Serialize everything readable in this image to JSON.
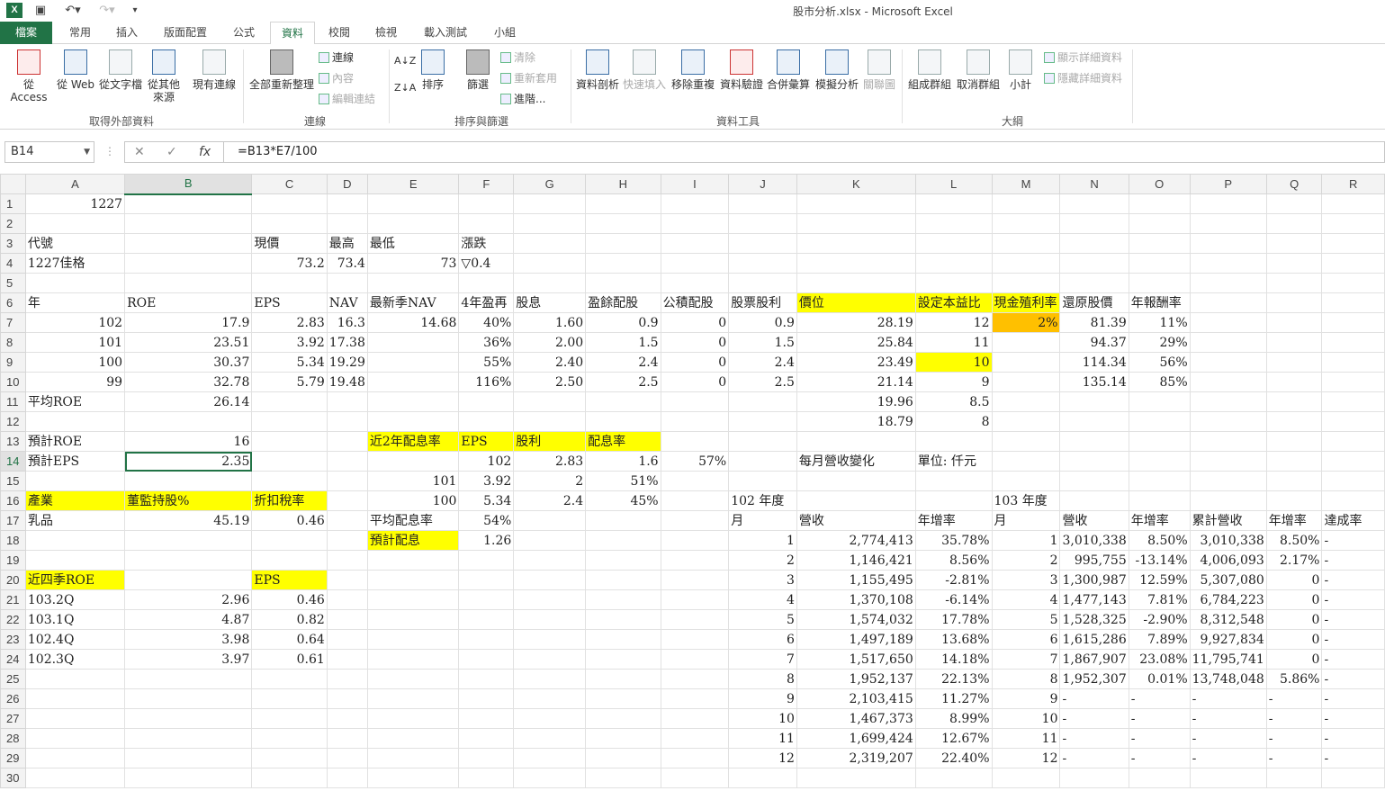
{
  "window": {
    "title": "股市分析.xlsx - Microsoft Excel",
    "app_icon": "excel-logo",
    "qa": [
      "save-icon",
      "undo-icon",
      "redo-icon",
      "customize-icon"
    ]
  },
  "tabs": [
    "檔案",
    "常用",
    "插入",
    "版面配置",
    "公式",
    "資料",
    "校閱",
    "檢視",
    "載入測試",
    "小組"
  ],
  "ribbon": {
    "ext": [
      "從 Access",
      "從 Web",
      "從文字檔",
      "從其他",
      "來源",
      "現有連線"
    ],
    "ext_group": "取得外部資料",
    "conn": [
      "全部重新整理",
      "連線",
      "內容",
      "編輯連結"
    ],
    "conn_group": "連線",
    "sort": [
      "排序",
      "篩選",
      "清除",
      "重新套用",
      "進階..."
    ],
    "sort_group": "排序與篩選",
    "tools": [
      "資料剖析",
      "快速填入",
      "移除重複",
      "資料驗證",
      "合併彙算",
      "模擬分析",
      "關聯圖"
    ],
    "tools_group": "資料工具",
    "outline": [
      "組成群組",
      "取消群組",
      "小計",
      "顯示詳細資料",
      "隱藏詳細資料"
    ],
    "outline_group": "大綱"
  },
  "formula_bar": {
    "name_box": "B14",
    "formula": "=B13*E7/100"
  },
  "sheet": {
    "cols": [
      "A",
      "B",
      "C",
      "D",
      "E",
      "F",
      "G",
      "H",
      "I",
      "J",
      "K",
      "L",
      "M",
      "N",
      "O",
      "P",
      "Q",
      "R"
    ],
    "rows": [
      [
        "1227",
        "",
        "",
        "",
        "",
        "",
        "",
        "",
        "",
        "",
        "",
        "",
        "",
        "",
        "",
        "",
        "",
        ""
      ],
      [
        "",
        "",
        "",
        "",
        "",
        "",
        "",
        "",
        "",
        "",
        "",
        "",
        "",
        "",
        "",
        "",
        "",
        ""
      ],
      [
        "代號",
        "",
        "現價",
        "最高",
        "最低",
        "漲跌",
        "",
        "",
        "",
        "",
        "",
        "",
        "",
        "",
        "",
        "",
        "",
        ""
      ],
      [
        "1227佳格",
        "",
        "73.2",
        "73.4",
        "73",
        "▽0.4",
        "",
        "",
        "",
        "",
        "",
        "",
        "",
        "",
        "",
        "",
        "",
        ""
      ],
      [
        "",
        "",
        "",
        "",
        "",
        "",
        "",
        "",
        "",
        "",
        "",
        "",
        "",
        "",
        "",
        "",
        "",
        ""
      ],
      [
        "年",
        "ROE",
        "EPS",
        "NAV",
        "最新季NAV",
        "4年盈再",
        "股息",
        "盈餘配股",
        "公積配股",
        "股票股利",
        "價位",
        "設定本益比",
        "現金殖利率",
        "還原股價",
        "年報酬率",
        "",
        "",
        ""
      ],
      [
        "102",
        "17.9",
        "2.83",
        "16.3",
        "14.68",
        "40%",
        "1.60",
        "0.9",
        "0",
        "0.9",
        "28.19",
        "12",
        "2%",
        "81.39",
        "11%",
        "",
        "",
        ""
      ],
      [
        "101",
        "23.51",
        "3.92",
        "17.38",
        "",
        "36%",
        "2.00",
        "1.5",
        "0",
        "1.5",
        "25.84",
        "11",
        "",
        "94.37",
        "29%",
        "",
        "",
        ""
      ],
      [
        "100",
        "30.37",
        "5.34",
        "19.29",
        "",
        "55%",
        "2.40",
        "2.4",
        "0",
        "2.4",
        "23.49",
        "10",
        "",
        "114.34",
        "56%",
        "",
        "",
        ""
      ],
      [
        "99",
        "32.78",
        "5.79",
        "19.48",
        "",
        "116%",
        "2.50",
        "2.5",
        "0",
        "2.5",
        "21.14",
        "9",
        "",
        "135.14",
        "85%",
        "",
        "",
        ""
      ],
      [
        "平均ROE",
        "26.14",
        "",
        "",
        "",
        "",
        "",
        "",
        "",
        "",
        "19.96",
        "8.5",
        "",
        "",
        "",
        "",
        "",
        ""
      ],
      [
        "",
        "",
        "",
        "",
        "",
        "",
        "",
        "",
        "",
        "",
        "18.79",
        "8",
        "",
        "",
        "",
        "",
        "",
        ""
      ],
      [
        "預計ROE",
        "16",
        "",
        "",
        "近2年配息率",
        "EPS",
        "股利",
        "配息率",
        "",
        "",
        "",
        "",
        "",
        "",
        "",
        "",
        "",
        ""
      ],
      [
        "預計EPS",
        "2.35",
        "",
        "",
        "",
        "102",
        "2.83",
        "1.6",
        "57%",
        "",
        "每月營收變化",
        "單位: 仟元",
        "",
        "",
        "",
        "",
        "",
        ""
      ],
      [
        "",
        "",
        "",
        "",
        "101",
        "3.92",
        "2",
        "51%",
        "",
        "",
        "",
        "",
        "",
        "",
        "",
        "",
        "",
        ""
      ],
      [
        "產業",
        "董監持股%",
        "折扣稅率",
        "",
        "100",
        "5.34",
        "2.4",
        "45%",
        "",
        "102 年度",
        "",
        "",
        "103 年度",
        "",
        "",
        "",
        "",
        ""
      ],
      [
        "乳品",
        "45.19",
        "0.46",
        "",
        "平均配息率",
        "54%",
        "",
        "",
        "",
        "月",
        "營收",
        "年增率",
        "月",
        "營收",
        "年增率",
        "累計營收",
        "年增率",
        "達成率"
      ],
      [
        "",
        "",
        "",
        "",
        "預計配息",
        "1.26",
        "",
        "",
        "",
        "1",
        "2,774,413",
        "35.78%",
        "1",
        "3,010,338",
        "8.50%",
        "3,010,338",
        "8.50%",
        "-"
      ],
      [
        "",
        "",
        "",
        "",
        "",
        "",
        "",
        "",
        "",
        "2",
        "1,146,421",
        "8.56%",
        "2",
        "995,755",
        "-13.14%",
        "4,006,093",
        "2.17%",
        "-"
      ],
      [
        "近四季ROE",
        "",
        "EPS",
        "",
        "",
        "",
        "",
        "",
        "",
        "3",
        "1,155,495",
        "-2.81%",
        "3",
        "1,300,987",
        "12.59%",
        "5,307,080",
        "0",
        "-"
      ],
      [
        "103.2Q",
        "2.96",
        "0.46",
        "",
        "",
        "",
        "",
        "",
        "",
        "4",
        "1,370,108",
        "-6.14%",
        "4",
        "1,477,143",
        "7.81%",
        "6,784,223",
        "0",
        "-"
      ],
      [
        "103.1Q",
        "4.87",
        "0.82",
        "",
        "",
        "",
        "",
        "",
        "",
        "5",
        "1,574,032",
        "17.78%",
        "5",
        "1,528,325",
        "-2.90%",
        "8,312,548",
        "0",
        "-"
      ],
      [
        "102.4Q",
        "3.98",
        "0.64",
        "",
        "",
        "",
        "",
        "",
        "",
        "6",
        "1,497,189",
        "13.68%",
        "6",
        "1,615,286",
        "7.89%",
        "9,927,834",
        "0",
        "-"
      ],
      [
        "102.3Q",
        "3.97",
        "0.61",
        "",
        "",
        "",
        "",
        "",
        "",
        "7",
        "1,517,650",
        "14.18%",
        "7",
        "1,867,907",
        "23.08%",
        "11,795,741",
        "0",
        "-"
      ],
      [
        "",
        "",
        "",
        "",
        "",
        "",
        "",
        "",
        "",
        "8",
        "1,952,137",
        "22.13%",
        "8",
        "1,952,307",
        "0.01%",
        "13,748,048",
        "5.86%",
        "-"
      ],
      [
        "",
        "",
        "",
        "",
        "",
        "",
        "",
        "",
        "",
        "9",
        "2,103,415",
        "11.27%",
        "9",
        "-",
        "-",
        "-",
        "-",
        "-"
      ],
      [
        "",
        "",
        "",
        "",
        "",
        "",
        "",
        "",
        "",
        "10",
        "1,467,373",
        "8.99%",
        "10",
        "-",
        "-",
        "-",
        "-",
        "-"
      ],
      [
        "",
        "",
        "",
        "",
        "",
        "",
        "",
        "",
        "",
        "11",
        "1,699,424",
        "12.67%",
        "11",
        "-",
        "-",
        "-",
        "-",
        "-"
      ],
      [
        "",
        "",
        "",
        "",
        "",
        "",
        "",
        "",
        "",
        "12",
        "2,319,207",
        "22.40%",
        "12",
        "-",
        "-",
        "-",
        "-",
        "-"
      ],
      [
        "",
        "",
        "",
        "",
        "",
        "",
        "",
        "",
        "",
        "",
        "",
        "",
        "",
        "",
        "",
        "",
        "",
        ""
      ]
    ],
    "highlight_yellow": [
      "K6",
      "L6",
      "L9",
      "E13",
      "F13",
      "G13",
      "H13",
      "A16",
      "B16",
      "C16",
      "E18",
      "A20",
      "C20",
      "M6"
    ],
    "highlight_orange": [
      "M7"
    ],
    "selected_cell": "B14",
    "selected_col": "B",
    "selected_row": 14,
    "colors": {
      "accent": "#217346",
      "highlight": "#ffff00",
      "orange": "#ffc000"
    }
  }
}
